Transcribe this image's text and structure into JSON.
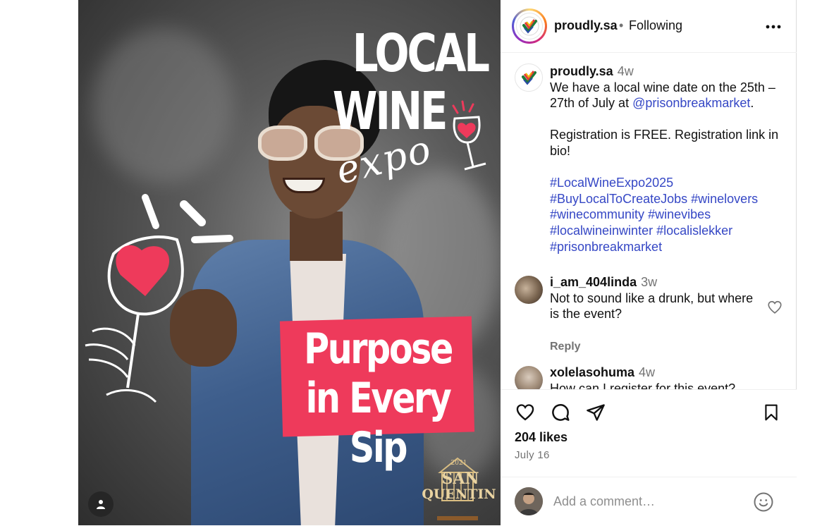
{
  "post": {
    "image": {
      "title_line1": "LOCAL",
      "title_line2": "WINE",
      "title_script": "expo",
      "banner": "Purpose in Every Sip",
      "logo_year": "2021",
      "logo_line1": "SAN",
      "logo_line2": "QUENTIN",
      "accent_color": "#ee3a5b"
    },
    "header": {
      "username": "proudly.sa",
      "separator": "•",
      "follow_status": "Following"
    },
    "caption": {
      "username": "proudly.sa",
      "time": "4w",
      "line1_before": "We have a local wine date on the 25th – 27th of July at ",
      "mention": "@prisonbreakmarket",
      "line1_after": ".",
      "line2": "Registration is FREE. Registration link in bio!",
      "hashtags": [
        "#LocalWineExpo2025",
        "#BuyLocalToCreateJobs",
        "#winelovers",
        "#winecommunity",
        "#winevibes",
        "#localwineinwinter",
        "#localislekker",
        "#prisonbreakmarket"
      ]
    },
    "comments": [
      {
        "username": "i_am_404linda",
        "time": "3w",
        "text": "Not to sound like a drunk, but where is the event?",
        "reply_label": "Reply"
      },
      {
        "username": "xolelasohuma",
        "time": "4w",
        "text": "How can I register for this event?"
      }
    ],
    "likes": "204 likes",
    "date": "July 16",
    "add_comment_placeholder": "Add a comment…",
    "link_color": "#3547c5"
  }
}
